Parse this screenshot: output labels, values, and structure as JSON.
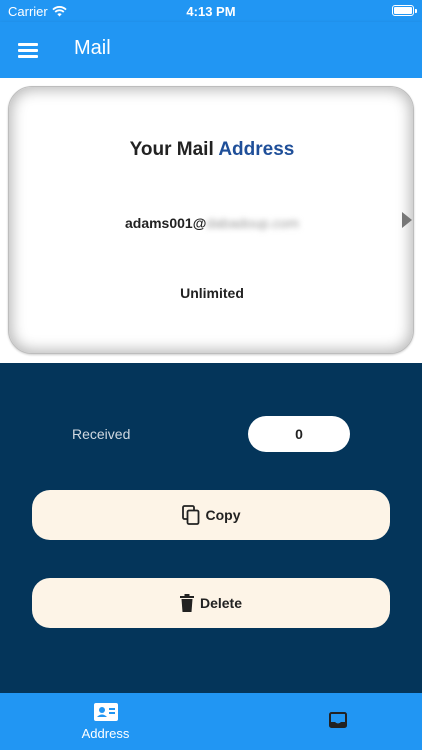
{
  "status_bar": {
    "carrier": "Carrier",
    "time": "4:13 PM"
  },
  "app_bar": {
    "title": "Mail"
  },
  "card": {
    "heading_prefix": "Your Mail ",
    "heading_accent": "Address",
    "email_visible": "adams001@",
    "email_blurred": "dabadoup.com",
    "limit": "Unlimited"
  },
  "stats": {
    "received_label": "Received",
    "received_count": "0"
  },
  "buttons": {
    "copy_label": "Copy",
    "delete_label": "Delete"
  },
  "bottom_nav": {
    "address_label": "Address"
  },
  "colors": {
    "primary": "#2196F3",
    "panel": "#04355a",
    "button_bg": "#fdf4e7",
    "accent_text": "#1f4f99"
  }
}
